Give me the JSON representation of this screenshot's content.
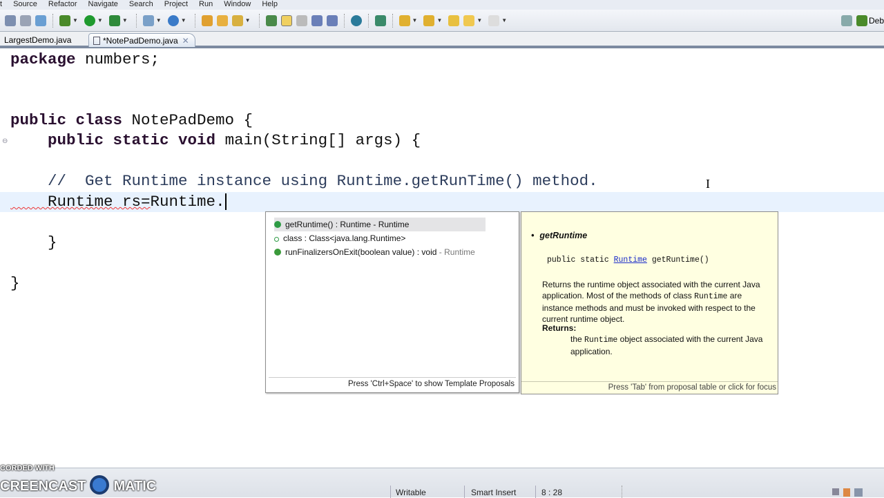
{
  "menu": [
    "t",
    "Source",
    "Refactor",
    "Navigate",
    "Search",
    "Project",
    "Run",
    "Window",
    "Help"
  ],
  "perspective": {
    "label": "Deb"
  },
  "tabs": [
    {
      "label": "LargestDemo.java"
    },
    {
      "label": "*NotePadDemo.java"
    }
  ],
  "code": {
    "l1a": "package",
    "l1b": " numbers;",
    "l4a": "public class",
    "l4b": " NotePadDemo {",
    "l5a": "    public static void",
    "l5b": " main(String[] args) {",
    "l7": "    //  Get Runtime instance using Runtime.getRunTime() method.",
    "l8a": "    Runtime rs=",
    "l8b": "Runtime",
    "l8c": ".",
    "l10": "    }",
    "l12": "}"
  },
  "proposals": [
    {
      "main": "getRuntime() : Runtime - Runtime",
      "suffix": ""
    },
    {
      "main": "class : Class<java.lang.Runtime>",
      "suffix": ""
    },
    {
      "main": "runFinalizersOnExit(boolean value) : void",
      "suffix": " - Runtime"
    }
  ],
  "proposal_footer": "Press 'Ctrl+Space' to show Template Proposals",
  "doc": {
    "title": "getRuntime",
    "sig_a": "public static ",
    "sig_link": "Runtime",
    "sig_b": " getRuntime()",
    "p1a": "Returns the runtime object associated with the current Java application. Most of the methods of class ",
    "p1code": "Runtime",
    "p1b": " are instance methods and must be invoked with respect to the current runtime object.",
    "returns_label": "Returns:",
    "r_a": "the ",
    "r_code": "Runtime",
    "r_b": " object associated with the current Java application.",
    "footer": "Press 'Tab' from proposal table or click for focus"
  },
  "status": {
    "writable": "Writable",
    "insert": "Smart Insert",
    "position": "8 : 28"
  },
  "watermark": {
    "line1": "CORDED WITH",
    "line2": "CREENCAST",
    "line3": "MATIC"
  }
}
